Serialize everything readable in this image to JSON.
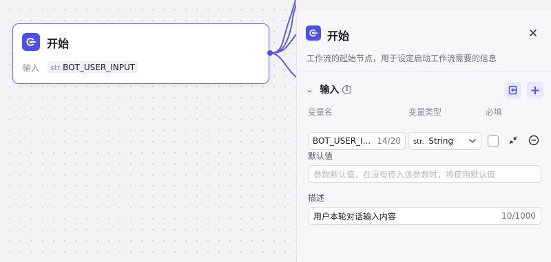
{
  "node": {
    "title": "开始",
    "input_label": "输入",
    "tag_type": "str.",
    "tag_name": "BOT_USER_INPUT"
  },
  "panel": {
    "title": "开始",
    "close": "✕",
    "description": "工作流的起始节点，用于设定启动工作流需要的信息",
    "section": {
      "title": "输入",
      "info": "i",
      "add": "+"
    },
    "columns": {
      "name": "变量名",
      "type": "变量类型",
      "required": "必填"
    },
    "row": {
      "name_value": "BOT_USER_I...",
      "name_count": "14/20",
      "type_prefix": "str.",
      "type_value": "String",
      "required": false
    },
    "default_label": "默认值",
    "default_placeholder": "参数默认值，在没有传入该参数时，将使用默认值",
    "desc_label": "描述",
    "desc_value": "用户本轮对话输入内容",
    "desc_count": "10/1000"
  },
  "colors": {
    "accent": "#4e4ff0",
    "node_border": "#6b6cf0",
    "panel_bg": "#f7f7f9"
  },
  "icons": [
    "start-node-icon",
    "close-icon",
    "chevron-down-icon",
    "info-icon",
    "import-icon",
    "plus-icon",
    "chevron-down-icon",
    "collapse-icon",
    "minus-circle-icon"
  ]
}
